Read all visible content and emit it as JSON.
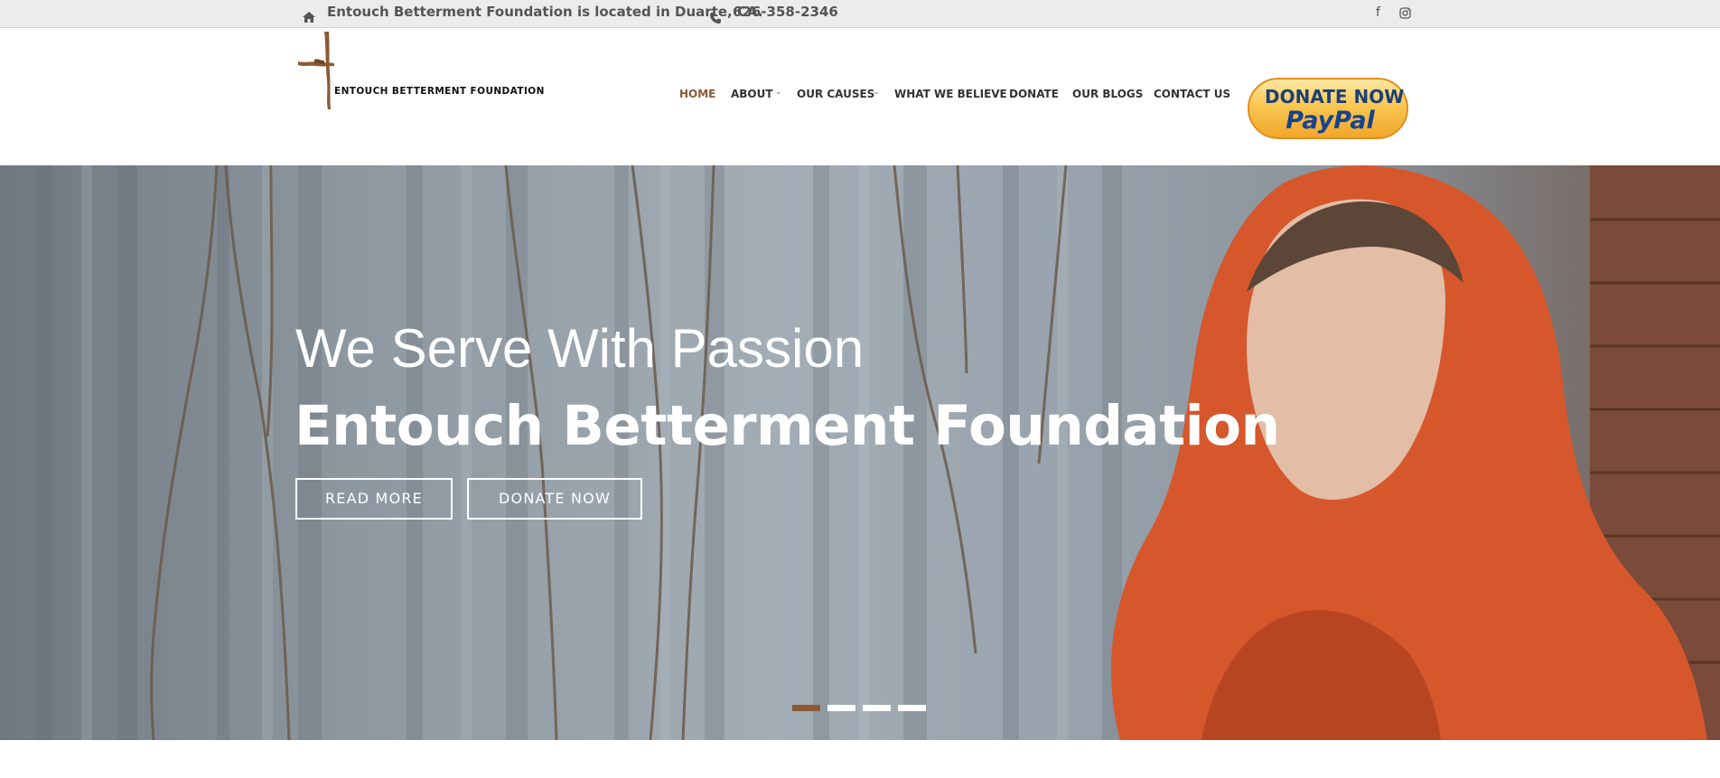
{
  "topbar": {
    "home_icon": "home-icon",
    "location": "Entouch Betterment Foundation is located in Duarte, CA.",
    "phone_icon": "phone-icon",
    "phone": "626-358-2346",
    "social": [
      "facebook-icon",
      "instagram-icon"
    ]
  },
  "header": {
    "logo_text": "ENTOUCH BETTERMENT FOUNDATION",
    "nav": [
      {
        "label": "HOME",
        "active": true
      },
      {
        "label": "ABOUT",
        "dropdown": true
      },
      {
        "label": "OUR CAUSES",
        "dropdown": true
      },
      {
        "label": "WHAT WE BELIEVE"
      },
      {
        "label": "DONATE"
      },
      {
        "label": "OUR BLOGS"
      },
      {
        "label": "CONTACT US"
      }
    ],
    "paypal": {
      "line1": "DONATE NOW",
      "line2": "PayPal"
    }
  },
  "hero": {
    "subtitle": "We Serve With Passion",
    "title": "Entouch Betterment Foundation",
    "buttons": {
      "read_more": "READ MORE",
      "donate_now": "DONATE NOW"
    },
    "slides": {
      "count": 4,
      "active_index": 0
    }
  },
  "colors": {
    "accent": "#8b5a35",
    "topbar_bg": "#ececec",
    "text": "#333333",
    "paypal_gold": "#f7b437",
    "paypal_blue": "#1c3f77",
    "jacket_orange": "#d6572c"
  }
}
